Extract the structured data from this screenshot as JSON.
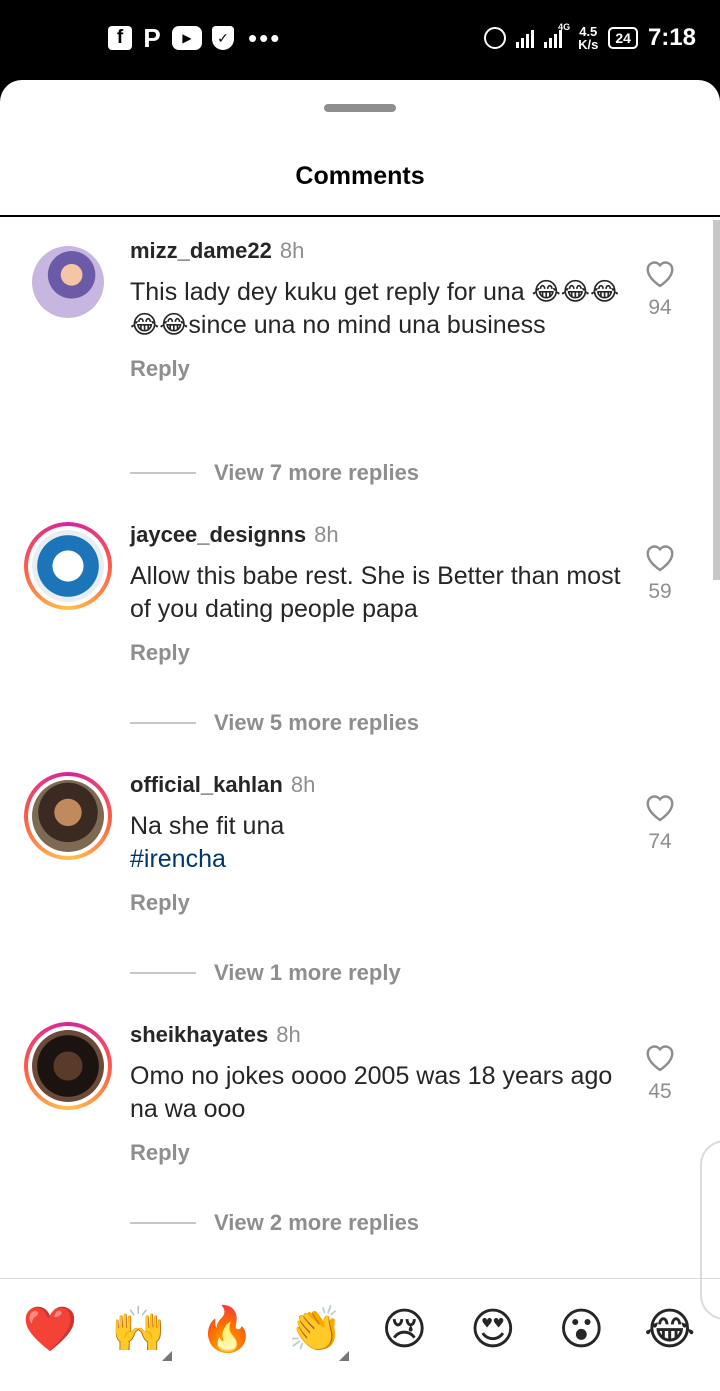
{
  "status_bar": {
    "app_icons": [
      "f",
      "P",
      "▶",
      "✓"
    ],
    "dots": "•••",
    "network_tag": "4G",
    "speed_value": "4.5",
    "speed_unit": "K/s",
    "battery": "24",
    "time": "7:18"
  },
  "sheet": {
    "title": "Comments"
  },
  "comments": [
    {
      "username": "mizz_dame22",
      "time": "8h",
      "text": "This lady dey kuku get reply for una 😂😂😂😂😂since una no mind una business",
      "tag": "",
      "reply_label": "Reply",
      "likes": "94",
      "view_more": "View 7 more replies"
    },
    {
      "username": "jaycee_designns",
      "time": "8h",
      "text": "Allow this babe rest. She is Better than most of you dating people papa",
      "tag": "",
      "reply_label": "Reply",
      "likes": "59",
      "view_more": "View 5 more replies"
    },
    {
      "username": "official_kahlan",
      "time": "8h",
      "text": "Na she fit una",
      "tag": "#irencha",
      "reply_label": "Reply",
      "likes": "74",
      "view_more": "View 1 more reply"
    },
    {
      "username": "sheikhayates",
      "time": "8h",
      "text": "Omo no jokes oooo 2005 was 18 years ago na wa ooo",
      "tag": "",
      "reply_label": "Reply",
      "likes": "45",
      "view_more": "View 2 more replies"
    }
  ],
  "emoji_bar": [
    "❤️",
    "🙌",
    "🔥",
    "👏",
    "😢",
    "😍",
    "😮",
    "😂"
  ],
  "colors": {
    "accent_text": "#262626",
    "muted": "#8e8e8e",
    "hashtag": "#00376b",
    "heart": "#ed4956"
  }
}
